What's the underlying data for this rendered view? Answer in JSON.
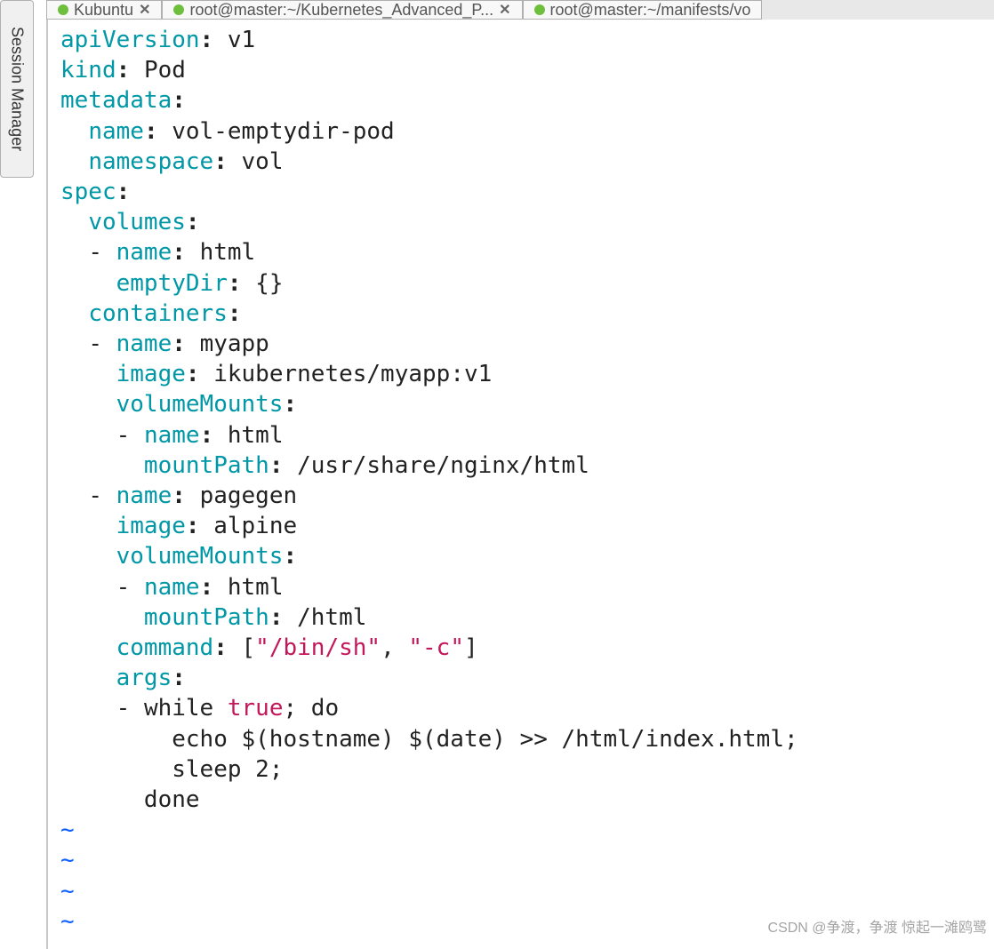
{
  "sidebar": {
    "session_label": "Session Manager"
  },
  "tabs": [
    {
      "label": "Kubuntu"
    },
    {
      "label": "root@master:~/Kubernetes_Advanced_P..."
    },
    {
      "label": "root@master:~/manifests/vo"
    }
  ],
  "colors": {
    "key": "#0097a7",
    "keyword": "#c2185b",
    "text": "#222222",
    "tilde": "#0b5fff"
  },
  "yaml": {
    "apiVersion_key": "apiVersion",
    "apiVersion_val": "v1",
    "kind_key": "kind",
    "kind_val": "Pod",
    "metadata_key": "metadata",
    "name_key": "name",
    "metadata_name_val": "vol-emptydir-pod",
    "namespace_key": "namespace",
    "namespace_val": "vol",
    "spec_key": "spec",
    "volumes_key": "volumes",
    "vol0_name_val": "html",
    "emptyDir_key": "emptyDir",
    "emptyDir_val": "{}",
    "containers_key": "containers",
    "c0_name_val": "myapp",
    "image_key": "image",
    "c0_image_val": "ikubernetes/myapp:v1",
    "volumeMounts_key": "volumeMounts",
    "c0_vm0_name_val": "html",
    "mountPath_key": "mountPath",
    "c0_vm0_mount_val": "/usr/share/nginx/html",
    "c1_name_val": "pagegen",
    "c1_image_val": "alpine",
    "c1_vm0_name_val": "html",
    "c1_vm0_mount_val": "/html",
    "command_key": "command",
    "command_open": "[",
    "command_v0": "\"/bin/sh\"",
    "command_sep": ", ",
    "command_v1": "\"-c\"",
    "command_close": "]",
    "args_key": "args",
    "args_l1_pre": "while ",
    "args_l1_kw": "true",
    "args_l1_post": "; do",
    "args_l2": "echo $(hostname) $(date) >> /html/index.html;",
    "args_l3": "sleep 2;",
    "args_l4": "done",
    "tilde": "~"
  },
  "watermark": "CSDN @争渡，争渡 惊起一滩鸥鹭"
}
